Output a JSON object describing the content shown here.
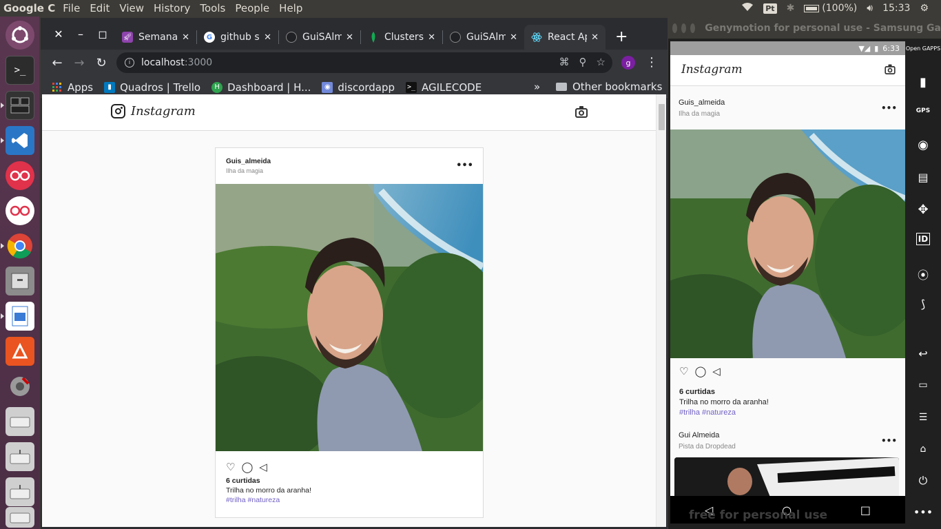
{
  "top_panel": {
    "app_name": "Google C",
    "menu": [
      "File",
      "Edit",
      "View",
      "History",
      "Tools",
      "People",
      "Help"
    ],
    "pt_badge": "Pt",
    "battery": "(100%)",
    "clock": "15:33"
  },
  "launcher": {
    "items": [
      "ubuntu-dash",
      "terminal",
      "terminator",
      "vscode",
      "flickr-a",
      "flickr-b",
      "chrome",
      "files-archive",
      "image-viewer",
      "software-center",
      "system-settings",
      "drive-a",
      "drive-b",
      "drive-c",
      "drive-d"
    ]
  },
  "chrome": {
    "tabs": [
      {
        "title": "Semana",
        "favicon": "purple-rocket-icon",
        "favicon_color": "#8e44ad"
      },
      {
        "title": "github s",
        "favicon": "google-icon",
        "favicon_color": "#ffffff"
      },
      {
        "title": "GuiSAlm",
        "favicon": "github-icon",
        "favicon_color": "#202124"
      },
      {
        "title": "Clusters",
        "favicon": "mongodb-leaf-icon",
        "favicon_color": "#13aa52"
      },
      {
        "title": "GuiSAlm",
        "favicon": "github-icon",
        "favicon_color": "#202124"
      },
      {
        "title": "React Ap",
        "favicon": "react-icon",
        "favicon_color": "#61dafb",
        "active": true
      }
    ],
    "url_host": "localhost",
    "url_port": ":3000",
    "profile_initial": "g",
    "bookmarks": [
      {
        "label": "Apps",
        "icon": "apps-grid-icon",
        "color": "#ea4335"
      },
      {
        "label": "Quadros | Trello",
        "icon": "trello-icon",
        "color": "#0079bf"
      },
      {
        "label": "Dashboard | H...",
        "icon": "heroku-icon",
        "color": "#2ea44f"
      },
      {
        "label": "discordapp",
        "icon": "discord-icon",
        "color": "#7289da"
      },
      {
        "label": "AGILECODE",
        "icon": "terminal-icon",
        "color": "#111111"
      }
    ],
    "more_bookmarks": "»",
    "other_bookmarks": "Other bookmarks"
  },
  "instagram": {
    "logo_text": "Instagram",
    "post": {
      "author": "Guis_almeida",
      "place": "Ilha da magia",
      "menu": "•••",
      "likes": "6 curtidas",
      "description": "Trilha no morro da aranha!",
      "hashtags": "#trilha #natureza"
    }
  },
  "genymotion": {
    "title": "Genymotion for personal use - Samsung Ga",
    "watermark": "free for personal use",
    "status_time": "6:33",
    "sidebar_labels": [
      "Open GAPPS",
      "GPS",
      "ID"
    ],
    "posts": [
      {
        "author": "Guis_almeida",
        "place": "Ilha da magia",
        "likes": "6 curtidas",
        "description": "Trilha no morro da aranha!",
        "hashtags": "#trilha #natureza"
      },
      {
        "author": "Gui Almeida",
        "place": "Pista da Dropdead"
      }
    ]
  },
  "colors": {
    "hashtag": "#7161c5",
    "panel": "#3c3b37",
    "chrome_dark": "#35363a"
  }
}
